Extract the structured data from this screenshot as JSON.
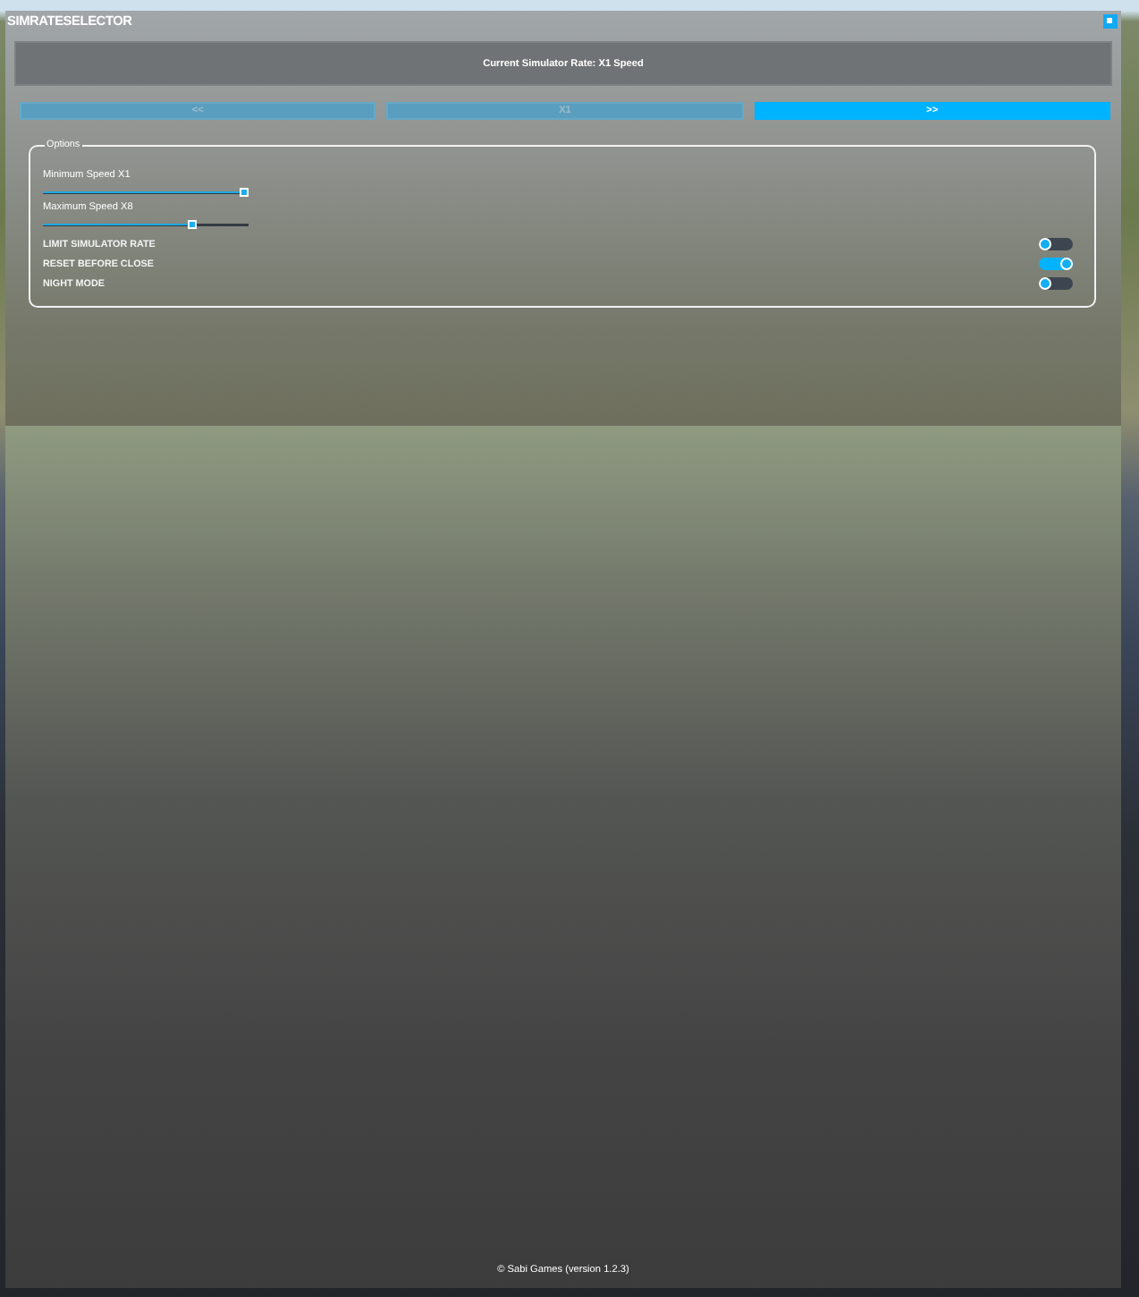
{
  "window": {
    "title": "SIMRATESELECTOR"
  },
  "rate_banner": {
    "text": "Current Simulator Rate: X1 Speed"
  },
  "rate_buttons": [
    {
      "label": "<<",
      "disabled": true
    },
    {
      "label": "X1",
      "disabled": true
    },
    {
      "label": ">>",
      "disabled": false
    }
  ],
  "options": {
    "legend": "Options",
    "sliders": [
      {
        "label": "Minimum Speed X1",
        "level": 1
      },
      {
        "label": "Maximum Speed X8",
        "level": 0.74
      }
    ],
    "toggles": [
      {
        "label": "LIMIT SIMULATOR RATE",
        "on": false
      },
      {
        "label": "RESET BEFORE CLOSE",
        "on": true
      },
      {
        "label": "NIGHT MODE",
        "on": false
      }
    ]
  },
  "footer": {
    "text": "© Sabi Games (version 1.2.3)"
  }
}
